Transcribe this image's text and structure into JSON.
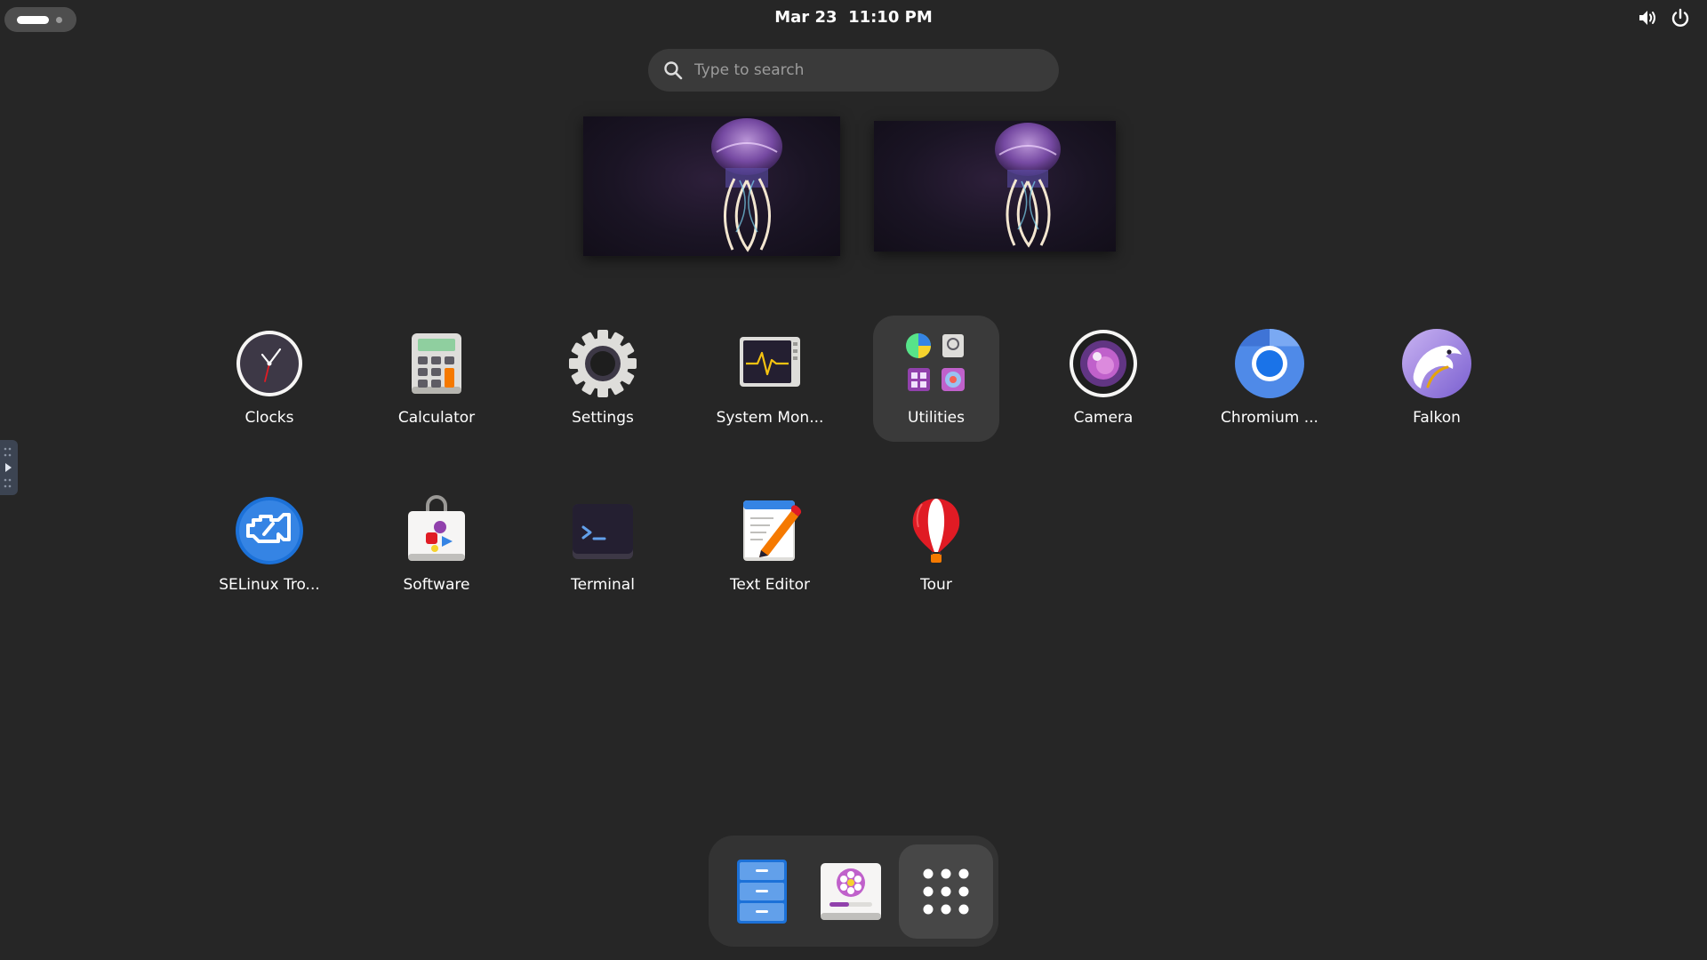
{
  "topbar": {
    "date": "Mar 23",
    "time": "11:10 PM",
    "activities_icon": "workspace-indicator-icon",
    "tray": [
      "volume-icon",
      "power-icon"
    ]
  },
  "search": {
    "placeholder": "Type to search",
    "value": ""
  },
  "workspaces": [
    {
      "wallpaper": "jellyfish-wallpaper"
    },
    {
      "wallpaper": "jellyfish-wallpaper"
    }
  ],
  "apps": [
    {
      "label": "Clocks",
      "icon": "clock-icon"
    },
    {
      "label": "Calculator",
      "icon": "calculator-icon"
    },
    {
      "label": "Settings",
      "icon": "gear-icon"
    },
    {
      "label": "System Mon...",
      "icon": "system-monitor-icon"
    },
    {
      "label": "Utilities",
      "icon": "utilities-folder-icon"
    },
    {
      "label": "Camera",
      "icon": "camera-icon"
    },
    {
      "label": "Chromium ...",
      "icon": "chromium-icon"
    },
    {
      "label": "Falkon",
      "icon": "falkon-icon"
    },
    {
      "label": "SELinux Tro...",
      "icon": "selinux-icon"
    },
    {
      "label": "Software",
      "icon": "software-bag-icon"
    },
    {
      "label": "Terminal",
      "icon": "terminal-icon"
    },
    {
      "label": "Text Editor",
      "icon": "text-editor-icon"
    },
    {
      "label": "Tour",
      "icon": "balloon-icon"
    }
  ],
  "dash": {
    "items": [
      "files-icon",
      "installer-icon",
      "show-apps-grid-icon"
    ]
  },
  "colors": {
    "background": "#262626",
    "surface": "#3a3a3a",
    "dash": "#333333",
    "accent_blue": "#3584e4"
  }
}
